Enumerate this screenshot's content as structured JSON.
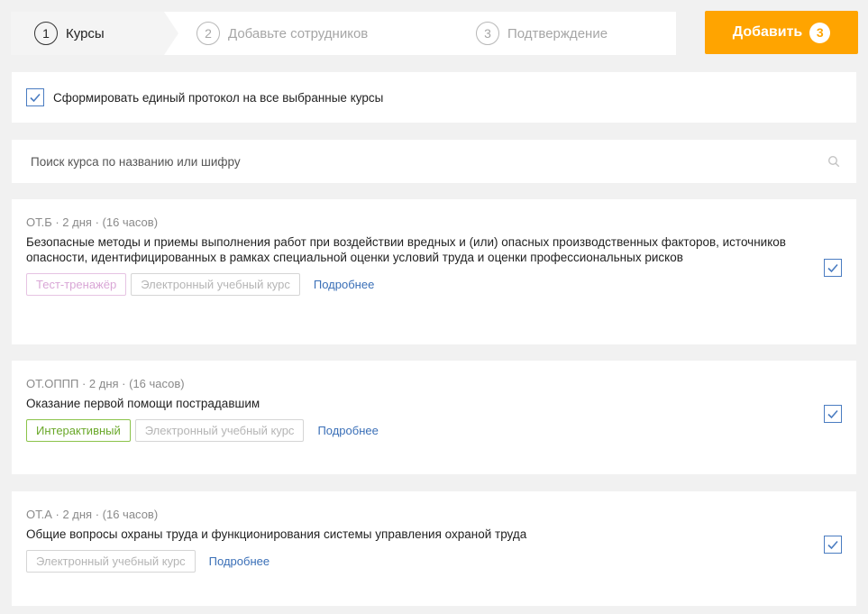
{
  "stepper": {
    "steps": [
      {
        "num": "1",
        "label": "Курсы"
      },
      {
        "num": "2",
        "label": "Добавьте сотрудников"
      },
      {
        "num": "3",
        "label": "Подтверждение"
      }
    ],
    "active_index": 0
  },
  "add_button": {
    "label": "Добавить",
    "count": "3"
  },
  "protocol": {
    "label": "Сформировать единый протокол на все выбранные курсы",
    "checked": true
  },
  "search": {
    "placeholder": "Поиск курса по названию или шифру",
    "icon": "search-icon"
  },
  "courses": [
    {
      "meta": "ОТ.Б · 2 дня · (16 часов)",
      "title": "Безопасные методы и приемы выполнения работ при воздействии вредных и (или) опасных производственных факторов, источников опасности, идентифицированных в рамках специальной оценки условий труда и оценки профессиональных рисков",
      "tags": [
        {
          "label": "Тест-тренажёр",
          "style": "pink"
        },
        {
          "label": "Электронный учебный курс",
          "style": "grey"
        }
      ],
      "more": "Подробнее",
      "checked": true
    },
    {
      "meta": "ОТ.ОППП · 2 дня · (16 часов)",
      "title": "Оказание первой помощи пострадавшим",
      "tags": [
        {
          "label": "Интерактивный",
          "style": "green"
        },
        {
          "label": "Электронный учебный курс",
          "style": "grey"
        }
      ],
      "more": "Подробнее",
      "checked": true
    },
    {
      "meta": "ОТ.А · 2 дня · (16 часов)",
      "title": "Общие вопросы охраны труда и функционирования системы управления охраной труда",
      "tags": [
        {
          "label": "Электронный учебный курс",
          "style": "grey"
        }
      ],
      "more": "Подробнее",
      "checked": true
    }
  ],
  "colors": {
    "accent": "#ffa400",
    "link": "#3a6fb7",
    "checkbox": "#4a7cc1",
    "tag_green": "#6aa82a",
    "tag_pink": "#d9a6d6"
  }
}
